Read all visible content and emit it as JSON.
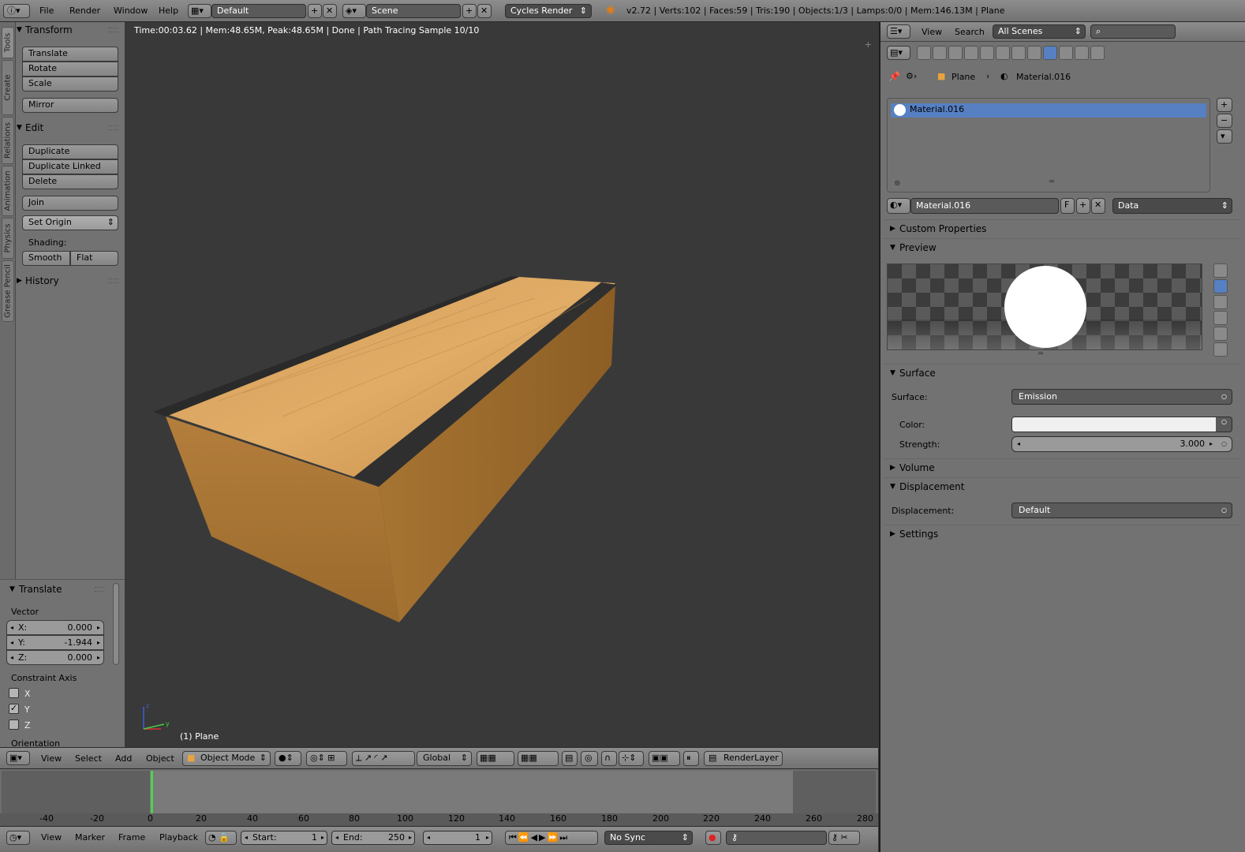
{
  "top_header": {
    "menus": [
      "File",
      "Render",
      "Window",
      "Help"
    ],
    "layout_name": "Default",
    "scene_name": "Scene",
    "render_engine": "Cycles Render",
    "stats": "v2.72 | Verts:102 | Faces:59 | Tris:190 | Objects:1/3 | Lamps:0/0 | Mem:146.13M | Plane"
  },
  "tool_tabs": [
    "Tools",
    "Create",
    "Relations",
    "Animation",
    "Physics",
    "Grease Pencil"
  ],
  "tool_shelf": {
    "transform_title": "Transform",
    "transform_buttons": [
      "Translate",
      "Rotate",
      "Scale"
    ],
    "mirror": "Mirror",
    "edit_title": "Edit",
    "edit_buttons": [
      "Duplicate",
      "Duplicate Linked",
      "Delete"
    ],
    "join": "Join",
    "set_origin": "Set Origin",
    "shading_label": "Shading:",
    "smooth": "Smooth",
    "flat": "Flat",
    "history_title": "History"
  },
  "operator_panel": {
    "title": "Translate",
    "vector_label": "Vector",
    "x_label": "X:",
    "x_value": "0.000",
    "y_label": "Y:",
    "y_value": "-1.944",
    "z_label": "Z:",
    "z_value": "0.000",
    "constraint_label": "Constraint Axis",
    "axis_x": "X",
    "axis_y": "Y",
    "axis_z": "Z",
    "orientation_label": "Orientation"
  },
  "viewport": {
    "info": "Time:00:03.62 | Mem:48.65M, Peak:48.65M | Done | Path Tracing Sample 10/10",
    "object_label": "(1) Plane"
  },
  "viewport_header": {
    "menus": [
      "View",
      "Select",
      "Add",
      "Object"
    ],
    "mode": "Object Mode",
    "orientation": "Global",
    "render_layer": "RenderLayer"
  },
  "timeline": {
    "ticks": [
      "-40",
      "-20",
      "0",
      "20",
      "40",
      "60",
      "80",
      "100",
      "120",
      "140",
      "160",
      "180",
      "200",
      "220",
      "240",
      "260",
      "280"
    ],
    "menus": [
      "View",
      "Marker",
      "Frame",
      "Playback"
    ],
    "start_label": "Start:",
    "start_value": "1",
    "end_label": "End:",
    "end_value": "250",
    "current_frame": "1",
    "sync": "No Sync"
  },
  "properties": {
    "header_menus": [
      "View",
      "Search"
    ],
    "scene_filter": "All Scenes",
    "breadcrumb_object": "Plane",
    "breadcrumb_material": "Material.016",
    "material_slot": "Material.016",
    "material_name": "Material.016",
    "fake_user": "F",
    "link_mode": "Data",
    "custom_properties": "Custom Properties",
    "preview": "Preview",
    "surface_title": "Surface",
    "surface_label": "Surface:",
    "surface_value": "Emission",
    "color_label": "Color:",
    "strength_label": "Strength:",
    "strength_value": "3.000",
    "volume": "Volume",
    "displacement_title": "Displacement",
    "displacement_label": "Displacement:",
    "displacement_value": "Default",
    "settings": "Settings"
  },
  "colors": {
    "accent_selected": "#5680c2",
    "viewport_bg": "#393939",
    "emission_color": "#f0f0f0",
    "current_frame": "#4fd24f"
  }
}
